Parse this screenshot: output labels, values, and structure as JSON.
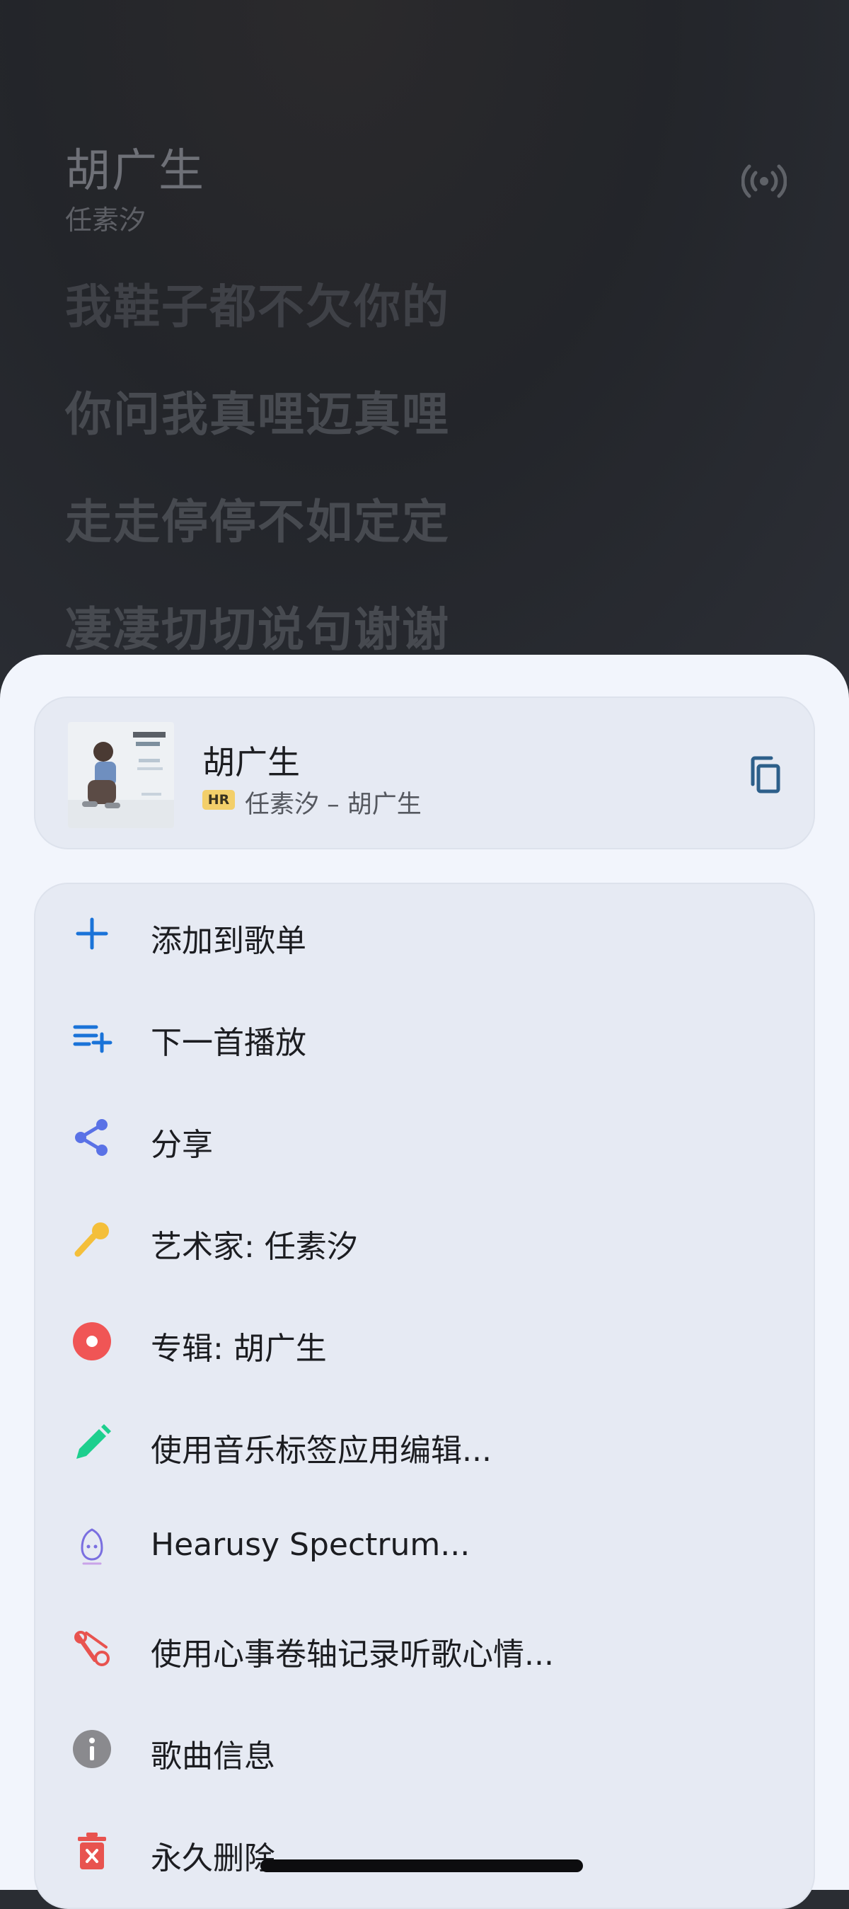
{
  "player": {
    "title": "胡广生",
    "artist": "任素汐",
    "lyrics": [
      "我鞋子都不欠你的",
      "你问我真哩迈真哩",
      "走走停停不如定定",
      "凄凄切切说句谢谢"
    ]
  },
  "song_card": {
    "title": "胡广生",
    "quality_badge": "HR",
    "subtitle": "任素汐 – 胡广生"
  },
  "menu": {
    "items": [
      {
        "label": "添加到歌单",
        "icon": "plus-icon",
        "color": "#1a73d8"
      },
      {
        "label": "下一首播放",
        "icon": "play-next-icon",
        "color": "#1a73d8"
      },
      {
        "label": "分享",
        "icon": "share-icon",
        "color": "#5a72e6"
      },
      {
        "label": "艺术家: 任素汐",
        "icon": "microphone-icon",
        "color": "#f4bf3a"
      },
      {
        "label": "专辑: 胡广生",
        "icon": "album-disc-icon",
        "color": "#f05555"
      },
      {
        "label": "使用音乐标签应用编辑...",
        "icon": "pencil-icon",
        "color": "#1dcf8e"
      },
      {
        "label": "Hearusy Spectrum...",
        "icon": "spectrum-app-icon",
        "color": "#7a6fe0"
      },
      {
        "label": "使用心事卷轴记录听歌心情...",
        "icon": "scroll-icon",
        "color": "#e8534f"
      },
      {
        "label": "歌曲信息",
        "icon": "info-icon",
        "color": "#8a8a8e"
      },
      {
        "label": "永久删除",
        "icon": "delete-icon",
        "color": "#e8534f"
      }
    ]
  },
  "colors": {
    "sheet_bg": "#f2f5fc",
    "card_bg": "#e6eaf3",
    "accent": "#1a73d8"
  }
}
